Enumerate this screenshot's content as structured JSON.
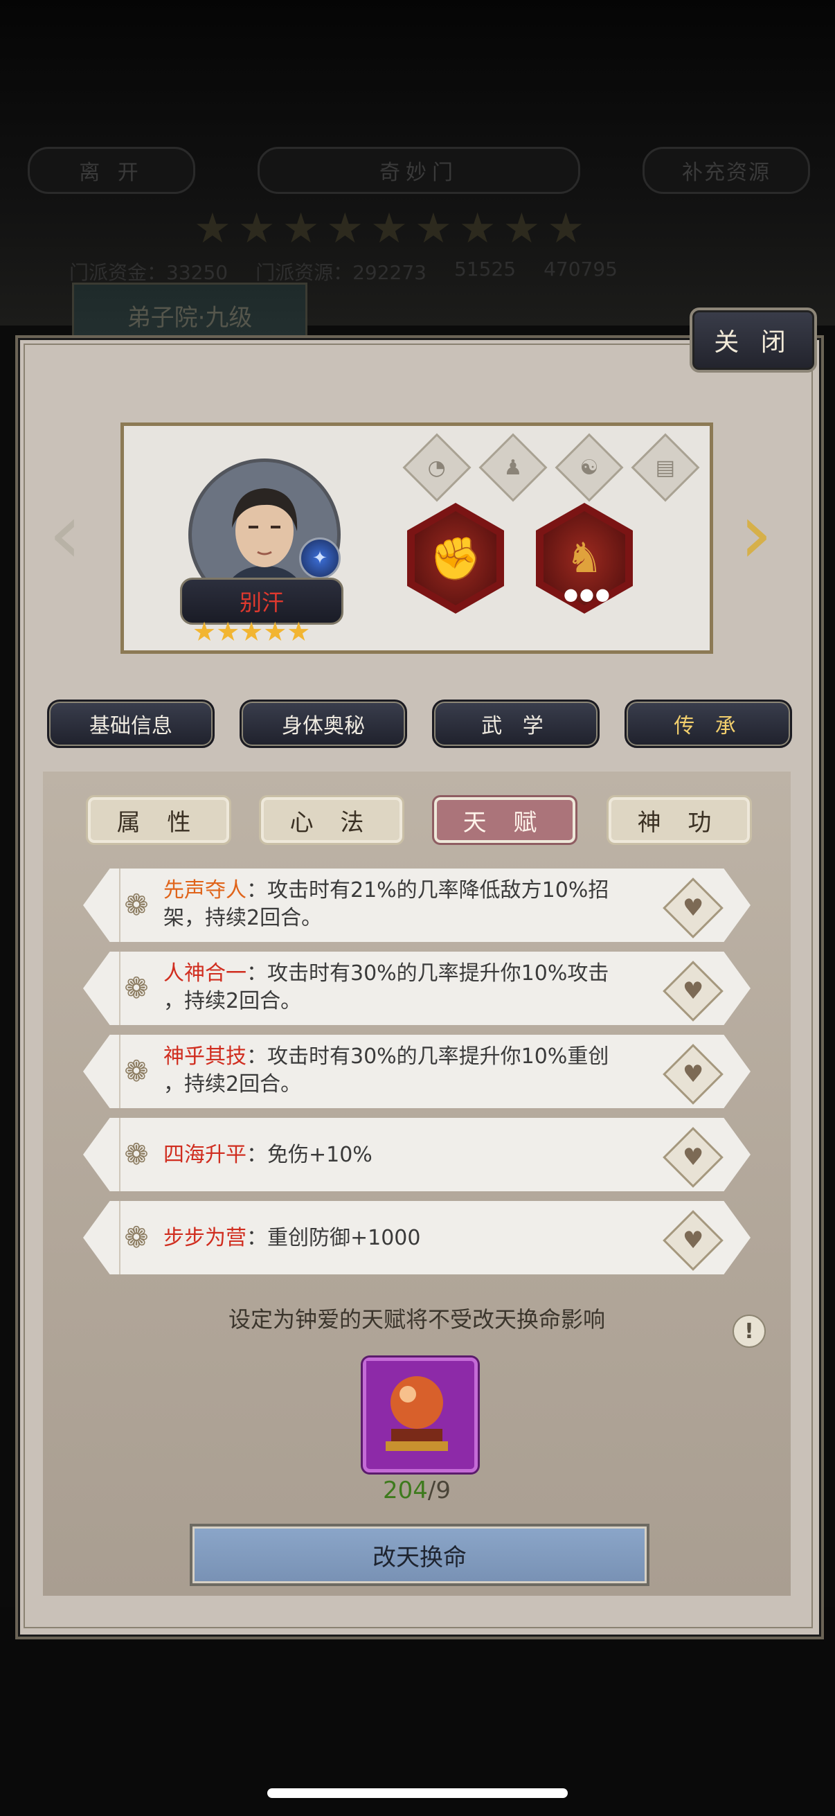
{
  "background": {
    "leave_label": "离 开",
    "sect_name": "奇妙门",
    "replenish_label": "补充资源",
    "stars": "★★★★★★★★★",
    "sect_funds_label": "门派资金：",
    "sect_funds_value": "33250",
    "sect_resources_label": "门派资源：",
    "sect_resources_value": "292273",
    "stat_a": "51525",
    "stat_b": "470795",
    "hall_title": "弟子院·九级"
  },
  "dialog": {
    "close_label": "关 闭",
    "hero": {
      "name": "别汗",
      "stars": "★★★★★",
      "equip_1_icon": "golden-gauntlet-icon",
      "equip_2_icon": "armored-horse-icon",
      "slot_icons": [
        "gem-slot-icon",
        "figure-slot-icon",
        "yin-yang-slot-icon",
        "book-slot-icon"
      ]
    },
    "main_tabs": [
      "基础信息",
      "身体奥秘",
      "武 学",
      "传 承"
    ],
    "main_tab_active": "传 承",
    "sub_tabs": [
      "属 性",
      "心 法",
      "天 赋",
      "神 功"
    ],
    "sub_tab_active": "天 赋",
    "talents": [
      {
        "name": "先声夺人",
        "sep": "：",
        "line1": "攻击时有21%的几率降低敌方10%招",
        "line2": "架，持续2回合。"
      },
      {
        "name": "人神合一",
        "sep": "：",
        "line1": "攻击时有30%的几率提升你10%攻击",
        "line2": "，持续2回合。"
      },
      {
        "name": "神乎其技",
        "sep": "：",
        "line1": "攻击时有30%的几率提升你10%重创",
        "line2": "，持续2回合。"
      },
      {
        "name": "四海升平",
        "sep": "：",
        "line1": "免伤+10%",
        "line2": ""
      },
      {
        "name": "步步为营",
        "sep": "：",
        "line1": "重创防御+1000",
        "line2": ""
      }
    ],
    "note": "设定为钟爱的天赋将不受改天换命影响",
    "info_label": "!",
    "item_count_have": "204",
    "item_count_sep": "/",
    "item_count_need": "9",
    "action_label": "改天换命"
  }
}
